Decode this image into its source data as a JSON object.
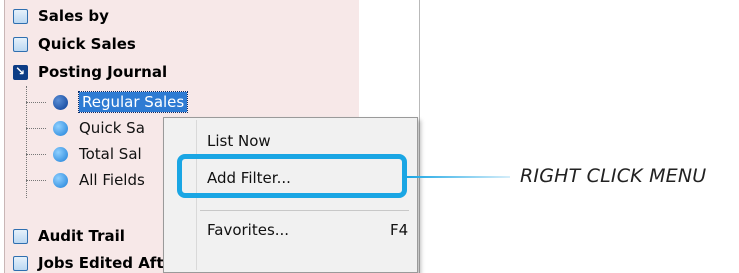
{
  "tree": {
    "items": [
      {
        "label": "Sales by",
        "icon": "folder-icon"
      },
      {
        "label": "Quick Sales",
        "icon": "folder-icon"
      },
      {
        "label": "Posting Journal",
        "icon": "open-folder-icon"
      }
    ],
    "children": [
      {
        "label": "Regular Sales",
        "selected": true
      },
      {
        "label": "Quick Sa"
      },
      {
        "label": "Total Sal"
      },
      {
        "label": "All Fields"
      }
    ],
    "after_items": [
      {
        "label": "Audit Trail"
      },
      {
        "label": "Jobs Edited After Posting"
      }
    ]
  },
  "context_menu": {
    "items": [
      {
        "label": "List Now",
        "shortcut": ""
      },
      {
        "label": "Add Filter...",
        "shortcut": ""
      },
      {
        "label": "Favorites...",
        "shortcut": "F4"
      }
    ]
  },
  "callout": {
    "text": "RIGHT CLICK MENU",
    "color": "#1aa6e4"
  }
}
